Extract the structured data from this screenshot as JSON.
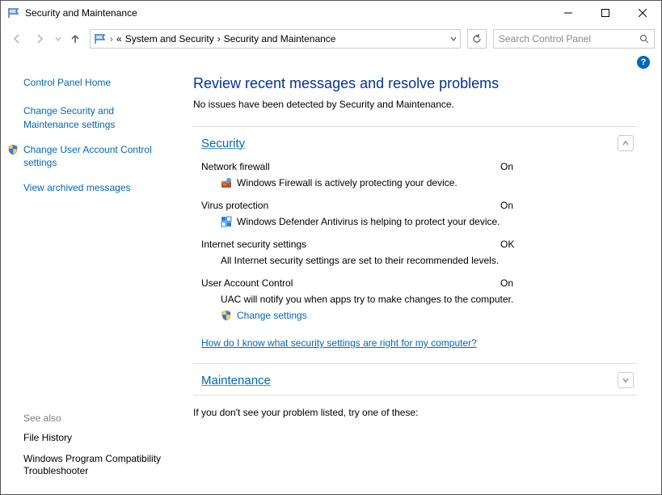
{
  "titlebar": {
    "title": "Security and Maintenance"
  },
  "breadcrumb": {
    "prefix": "«",
    "seg1": "System and Security",
    "sep": "›",
    "seg2": "Security and Maintenance"
  },
  "search": {
    "placeholder": "Search Control Panel"
  },
  "sidebar": {
    "home": "Control Panel Home",
    "links": {
      "change_sec": "Change Security and Maintenance settings",
      "change_uac": "Change User Account Control settings",
      "view_arch": "View archived messages"
    },
    "see_also": {
      "heading": "See also",
      "file_history": "File History",
      "wpct": "Windows Program Compatibility Troubleshooter"
    }
  },
  "main": {
    "heading": "Review recent messages and resolve problems",
    "no_issues": "No issues have been detected by Security and Maintenance.",
    "security": {
      "title": "Security",
      "firewall": {
        "label": "Network firewall",
        "status": "On",
        "desc": "Windows Firewall is actively protecting your device."
      },
      "virus": {
        "label": "Virus protection",
        "status": "On",
        "desc": "Windows Defender Antivirus is helping to protect your device."
      },
      "internet": {
        "label": "Internet security settings",
        "status": "OK",
        "desc": "All Internet security settings are set to their recommended levels."
      },
      "uac": {
        "label": "User Account Control",
        "status": "On",
        "desc": "UAC will notify you when apps try to make changes to the computer.",
        "change": "Change settings"
      },
      "help_link": "How do I know what security settings are right for my computer?"
    },
    "maintenance": {
      "title": "Maintenance"
    },
    "tryone": "If you don't see your problem listed, try one of these:"
  }
}
